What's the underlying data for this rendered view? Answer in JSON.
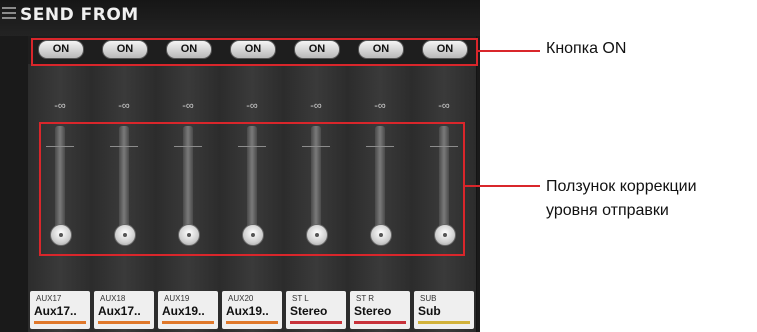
{
  "header": {
    "title": "SEND FROM"
  },
  "channels": [
    {
      "on_label": "ON",
      "level": "-∞",
      "top": "AUX17",
      "name": "Aux17..",
      "color": "#e0782a"
    },
    {
      "on_label": "ON",
      "level": "-∞",
      "top": "AUX18",
      "name": "Aux17..",
      "color": "#e0782a"
    },
    {
      "on_label": "ON",
      "level": "-∞",
      "top": "AUX19",
      "name": "Aux19..",
      "color": "#e0782a"
    },
    {
      "on_label": "ON",
      "level": "-∞",
      "top": "AUX20",
      "name": "Aux19..",
      "color": "#e0782a"
    },
    {
      "on_label": "ON",
      "level": "-∞",
      "top": "ST L",
      "name": "Stereo",
      "color": "#c8323a"
    },
    {
      "on_label": "ON",
      "level": "-∞",
      "top": "ST R",
      "name": "Stereo",
      "color": "#c8323a"
    },
    {
      "on_label": "ON",
      "level": "-∞",
      "top": "SUB",
      "name": "Sub",
      "color": "#d2b23a"
    }
  ],
  "annotations": {
    "on_button": "Кнопка ON",
    "slider_line1": "Ползунок коррекции",
    "slider_line2": "уровня отправки"
  },
  "colors": {
    "highlight": "#d9262b"
  }
}
